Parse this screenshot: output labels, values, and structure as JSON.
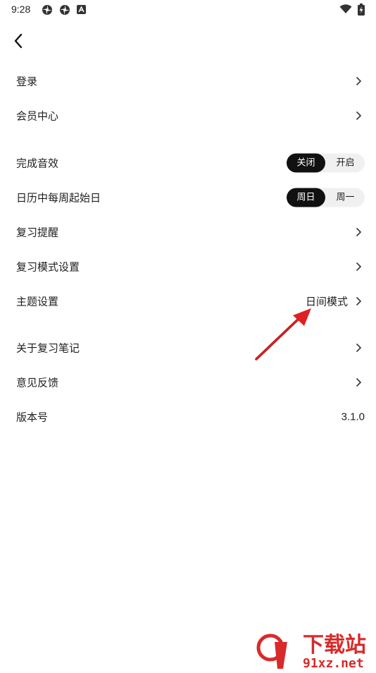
{
  "status_bar": {
    "time": "9:28",
    "icons": [
      "aperture-icon",
      "aperture-icon",
      "notification-a-icon",
      "wifi-icon",
      "battery-charging-icon"
    ]
  },
  "nav": {
    "back_icon": "chevron-left-icon"
  },
  "rows": {
    "login": {
      "label": "登录"
    },
    "member": {
      "label": "会员中心"
    },
    "sound": {
      "label": "完成音效",
      "options": [
        "关闭",
        "开启"
      ],
      "selected": "关闭"
    },
    "week_start": {
      "label": "日历中每周起始日",
      "options": [
        "周日",
        "周一"
      ],
      "selected": "周日"
    },
    "reminder": {
      "label": "复习提醒"
    },
    "mode": {
      "label": "复习模式设置"
    },
    "theme": {
      "label": "主题设置",
      "value": "日间模式"
    },
    "about": {
      "label": "关于复习笔记"
    },
    "feedback": {
      "label": "意见反馈"
    },
    "version": {
      "label": "版本号",
      "value": "3.1.0"
    }
  },
  "watermark": {
    "brand": "下载站",
    "domain": "91xz.net",
    "color": "#d82a2a"
  },
  "colors": {
    "annotation_arrow": "#e02020",
    "segment_active": "#111111",
    "segment_bg": "#f0f0f0"
  }
}
